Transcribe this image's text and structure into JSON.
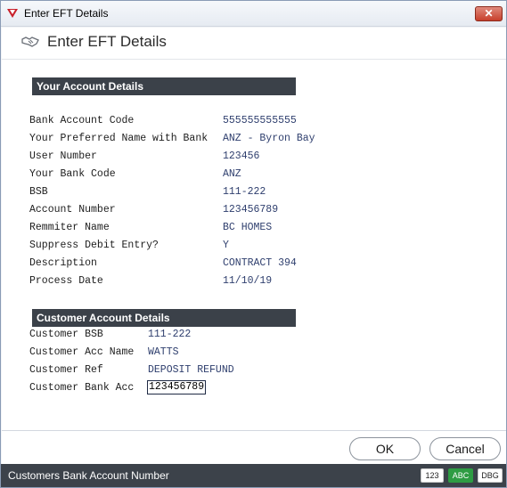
{
  "window": {
    "title": "Enter EFT Details",
    "close_label": "✕"
  },
  "header": {
    "title": "Enter EFT Details"
  },
  "your_account": {
    "section_title": "Your Account Details",
    "rows": [
      {
        "label": "Bank Account Code",
        "value": "555555555555"
      },
      {
        "label": "Your Preferred Name with Bank",
        "value": "ANZ - Byron Bay"
      },
      {
        "label": "User Number",
        "value": "123456"
      },
      {
        "label": "Your Bank Code",
        "value": "ANZ"
      },
      {
        "label": "BSB",
        "value": "111-222"
      },
      {
        "label": "Account Number",
        "value": "123456789"
      },
      {
        "label": "Remmiter Name",
        "value": "BC HOMES"
      },
      {
        "label": "Suppress Debit Entry?",
        "value": "Y"
      },
      {
        "label": "Description",
        "value": "CONTRACT 394"
      },
      {
        "label": "Process Date",
        "value": "11/10/19"
      }
    ]
  },
  "customer_account": {
    "section_title": "Customer Account Details",
    "rows": [
      {
        "label": "Customer BSB",
        "value": "111-222"
      },
      {
        "label": "Customer Acc Name",
        "value": "WATTS"
      },
      {
        "label": "Customer Ref",
        "value": "DEPOSIT REFUND"
      },
      {
        "label": "Customer Bank Acc",
        "value": "123456789"
      }
    ]
  },
  "buttons": {
    "ok": "OK",
    "cancel": "Cancel"
  },
  "status": {
    "text": "Customers Bank Account Number",
    "badges": {
      "num": "123",
      "abc": "ABC",
      "dbg": "DBG"
    }
  },
  "colors": {
    "accent_green": "#2e9c43",
    "section_bg": "#3b4149",
    "value_text": "#2f3f6e",
    "close_red": "#c7402c"
  }
}
